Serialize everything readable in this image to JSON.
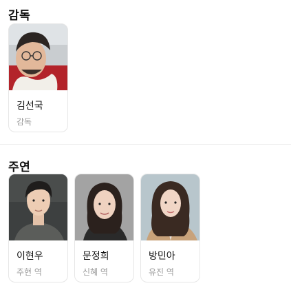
{
  "director_section": {
    "title": "감독",
    "people": [
      {
        "name": "김선국",
        "role": "감독"
      }
    ]
  },
  "cast_section": {
    "title": "주연",
    "people": [
      {
        "name": "이현우",
        "role": "주현 역"
      },
      {
        "name": "문정희",
        "role": "신혜 역"
      },
      {
        "name": "방민아",
        "role": "유진 역"
      }
    ]
  }
}
